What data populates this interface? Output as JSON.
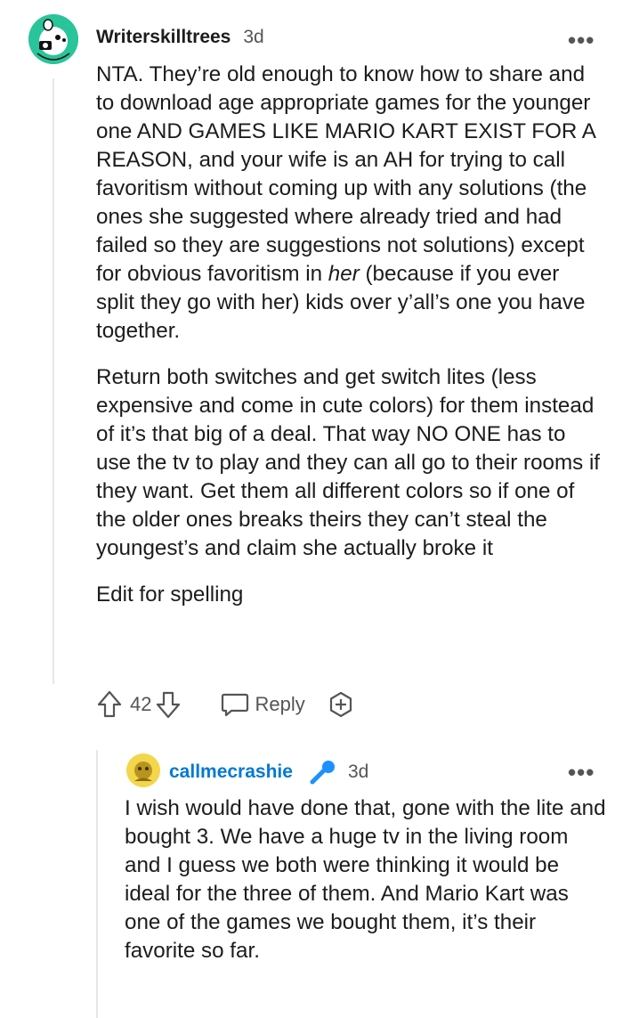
{
  "comment": {
    "username": "Writerskilltrees",
    "time": "3d",
    "more": "•••",
    "paragraphs": [
      {
        "before": "NTA. They’re old enough to know how to share and to download age appropriate games for the younger one AND GAMES LIKE MARIO KART EXIST FOR A REASON, and your wife is an AH for trying to call favoritism without coming up with any solutions (the ones she suggested where already tried and had failed so they are suggestions not solutions) except for obvious favoritism in ",
        "em": "her",
        "after": " (because if you ever split they go with her) kids over y’all’s one you have together."
      },
      {
        "text": "Return both switches and get switch lites (less expensive and come in cute colors) for them instead of it’s that big of a deal. That way NO ONE has to use the tv to play and they can all go to their rooms if they want. Get them all different colors so if one of the older ones breaks theirs they can’t steal the youngest’s and claim she actually broke it"
      },
      {
        "text": "Edit for spelling"
      }
    ],
    "votes": "42",
    "reply_label": "Reply"
  },
  "reply": {
    "username": "callmecrashie",
    "time": "3d",
    "more": "•••",
    "text": "I wish would have done that, gone with the lite and bought 3. We have a huge tv in the living room and I guess we both were thinking it would be ideal for the three of them. And Mario Kart was one of the games we bought them, it’s their favorite so far."
  },
  "colors": {
    "username_reply": "#0079d3",
    "mic_badge": "#0079d3",
    "avatar1_bg": "#1abc9c",
    "avatar2_bg": "#f5d94a"
  }
}
